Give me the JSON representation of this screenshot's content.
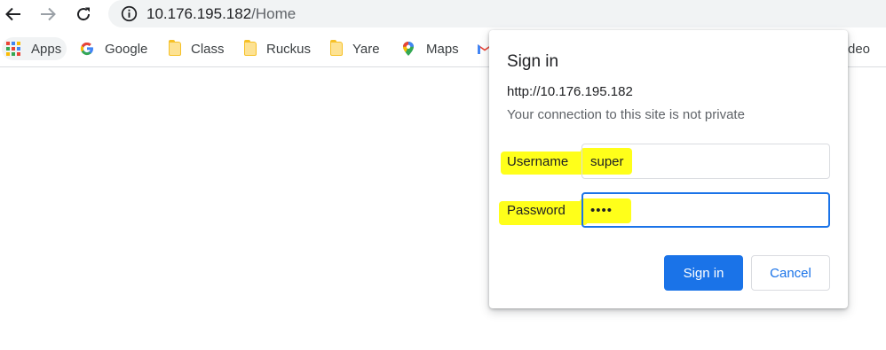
{
  "browser": {
    "url_host": "10.176.195.182",
    "url_path": "/Home",
    "icons": {
      "back": "arrow-left-icon",
      "forward": "arrow-right-icon",
      "reload": "reload-icon",
      "site_info": "info-icon"
    }
  },
  "bookmarks": [
    {
      "label": "Apps",
      "icon": "apps-grid-icon"
    },
    {
      "label": "Google",
      "icon": "google-g-icon"
    },
    {
      "label": "Class",
      "icon": "folder-icon"
    },
    {
      "label": "Ruckus",
      "icon": "folder-icon"
    },
    {
      "label": "Yare",
      "icon": "folder-icon"
    },
    {
      "label": "Maps",
      "icon": "maps-pin-icon"
    },
    {
      "label": "",
      "icon": "gmail-icon"
    },
    {
      "label": "deo",
      "icon": ""
    }
  ],
  "dialog": {
    "title": "Sign in",
    "origin": "http://10.176.195.182",
    "warning": "Your connection to this site is not private",
    "username_label": "Username",
    "username_value": "super",
    "password_label": "Password",
    "password_value": "••••",
    "sign_in_button": "Sign in",
    "cancel_button": "Cancel"
  },
  "colors": {
    "highlight": "#ffff1a",
    "primary": "#1a73e8",
    "omnibox": "#f1f3f4"
  }
}
